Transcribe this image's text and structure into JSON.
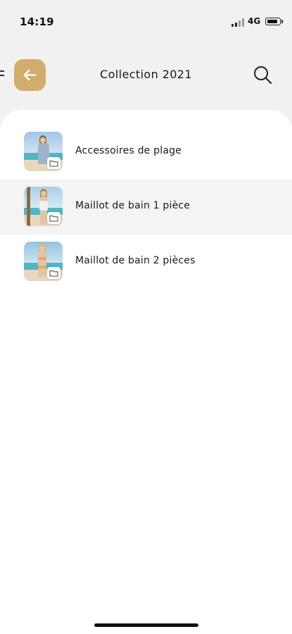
{
  "status_bar": {
    "time": "14:19",
    "network": "4G",
    "battery_level": 0.85
  },
  "header": {
    "title": "Collection 2021",
    "back_icon": "arrow-left-icon",
    "search_icon": "search-icon"
  },
  "colors": {
    "accent": "#d2ac6a",
    "background": "#f1f1f1",
    "card": "#ffffff",
    "active_row": "#f4f4f4"
  },
  "list": {
    "items": [
      {
        "label": "Accessoires de plage",
        "thumbnail": "beach-model-photo",
        "badge_icon": "folder-icon",
        "highlighted": false
      },
      {
        "label": "Maillot de bain 1 pièce",
        "thumbnail": "beach-model-photo",
        "badge_icon": "folder-icon",
        "highlighted": true
      },
      {
        "label": "Maillot de bain 2 pièces",
        "thumbnail": "beach-model-photo",
        "badge_icon": "folder-icon",
        "highlighted": false
      }
    ]
  }
}
